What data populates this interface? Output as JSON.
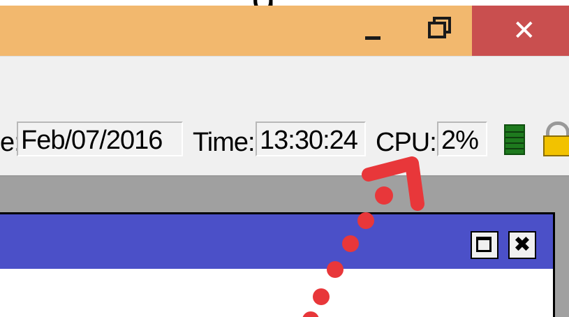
{
  "window": {
    "title_glyph": "g",
    "minimize_icon": "minimize-icon",
    "maximize_icon": "restore-icon",
    "close_label": "✕"
  },
  "statusbar": {
    "date_label": "e:",
    "date_value": "Feb/07/2016",
    "time_label": "Time:",
    "time_value": "13:30:24",
    "cpu_label": "CPU:",
    "cpu_value": "2%"
  },
  "indicators": {
    "cpu_meter_icon": "cpu-meter-icon",
    "lock_icon": "lock-icon"
  },
  "child_window": {
    "maximize_icon": "maximize-icon",
    "close_label": "✖"
  },
  "annotation": {
    "color": "#e8373a"
  },
  "colors": {
    "titlebar": "#f2b86e",
    "close_button": "#c94f4f",
    "child_titlebar": "#4b50c8"
  }
}
